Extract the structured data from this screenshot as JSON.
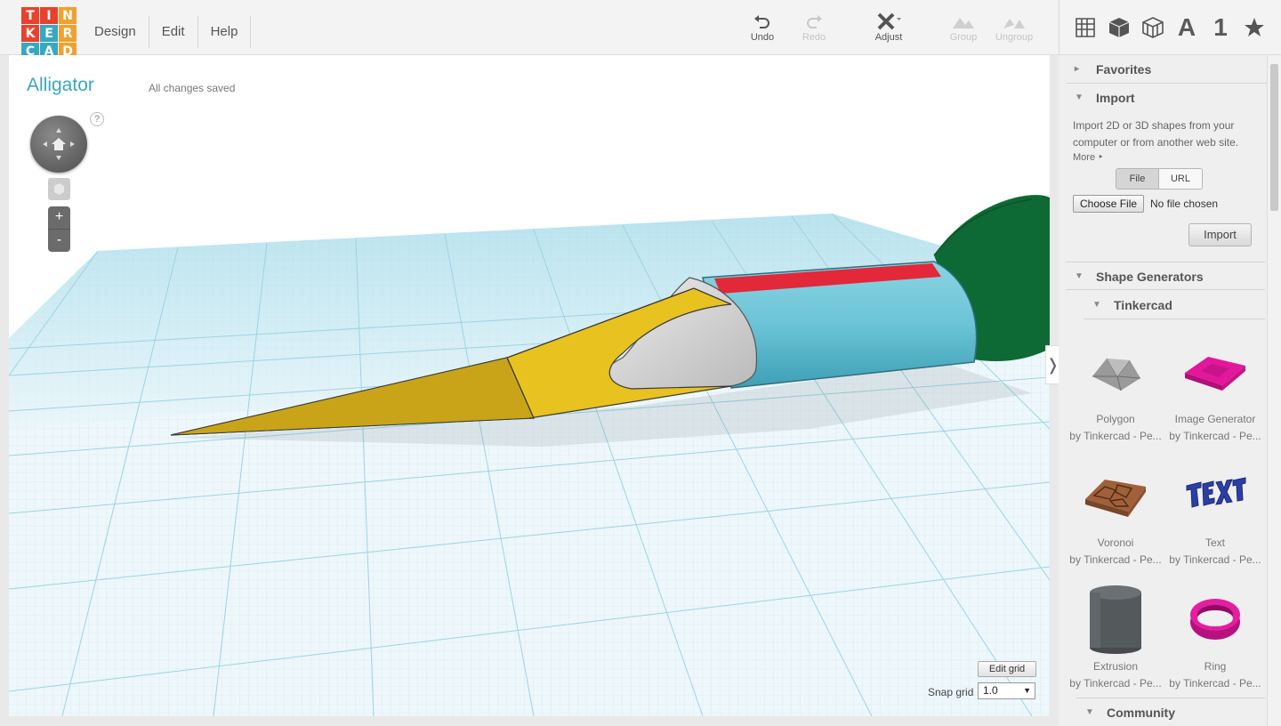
{
  "logo": {
    "letters": [
      "T",
      "I",
      "N",
      "K",
      "E",
      "R",
      "C",
      "A",
      "D"
    ],
    "colors": [
      "#e8422e",
      "#e8422e",
      "#f0a12e",
      "#e8422e",
      "#3aa7c0",
      "#f0a12e",
      "#3aa7c0",
      "#3aa7c0",
      "#f0a12e"
    ]
  },
  "menu": {
    "items": [
      "Design",
      "Edit",
      "Help"
    ]
  },
  "toolbar": {
    "undo": "Undo",
    "redo": "Redo",
    "adjust": "Adjust",
    "group": "Group",
    "ungroup": "Ungroup"
  },
  "top_right_icons": {
    "letter": "A",
    "number": "1",
    "icons": [
      "grid-icon",
      "cube-icon",
      "cube-outline-icon",
      "text-a-icon",
      "number-icon",
      "star-icon"
    ]
  },
  "design": {
    "title": "Alligator",
    "status": "All changes saved",
    "help": "?"
  },
  "zoom": {
    "plus": "+",
    "minus": "-"
  },
  "grid": {
    "edit_label": "Edit grid",
    "snap_label": "Snap grid",
    "snap_value": "1.0"
  },
  "sidebar": {
    "favorites": "Favorites",
    "import": {
      "title": "Import",
      "description": "Import 2D or 3D shapes from your computer or from another web site.",
      "more": "More",
      "tab_file": "File",
      "tab_url": "URL",
      "choose_file": "Choose File",
      "no_file": "No file chosen",
      "import_button": "Import"
    },
    "shape_generators": "Shape Generators",
    "tinkercad": "Tinkercad",
    "community": "Community",
    "shapes": [
      {
        "name": "Polygon",
        "by": "by Tinkercad - Pe..."
      },
      {
        "name": "Image Generator",
        "by": "by Tinkercad - Pe..."
      },
      {
        "name": "Voronoi",
        "by": "by Tinkercad - Pe..."
      },
      {
        "name": "Text",
        "by": "by Tinkercad - Pe..."
      },
      {
        "name": "Extrusion",
        "by": "by Tinkercad - Pe..."
      },
      {
        "name": "Ring",
        "by": "by Tinkercad - Pe..."
      }
    ]
  },
  "colors": {
    "accent": "#3aa7c0",
    "yellow": "#e8c21e",
    "cyan": "#6cc5d6",
    "red": "#e3283a",
    "green": "#0e6a34",
    "grey": "#d8d8d8"
  }
}
